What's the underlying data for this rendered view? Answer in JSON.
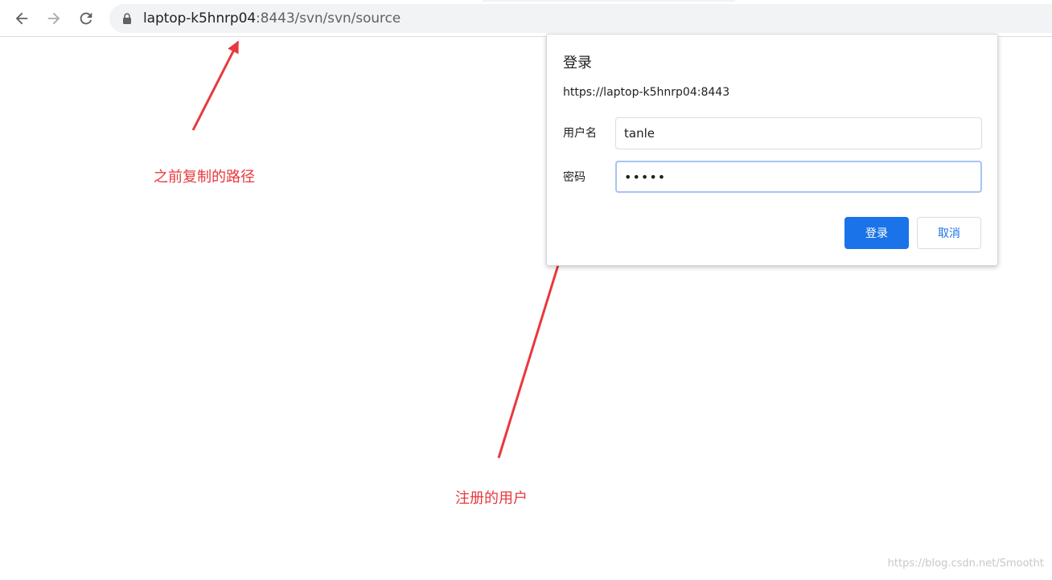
{
  "browser": {
    "url_host": "laptop-k5hnrp04",
    "url_rest": ":8443/svn/svn/source",
    "icons": {
      "back": "arrow-left-icon",
      "forward": "arrow-right-icon",
      "reload": "reload-icon",
      "lock": "lock-icon"
    }
  },
  "dialog": {
    "title": "登录",
    "origin": "https://laptop-k5hnrp04:8443",
    "username_label": "用户名",
    "username_value": "tanle",
    "password_label": "密码",
    "password_value": "•••••",
    "login_button": "登录",
    "cancel_button": "取消"
  },
  "annotations": {
    "url_note": "之前复制的路径",
    "user_note": "注册的用户",
    "color": "#e8383d"
  },
  "watermark": "https://blog.csdn.net/Smootht",
  "colors": {
    "accent": "#1a73e8",
    "focus_ring": "#a6c4f2",
    "omnibox_bg": "#f1f3f4"
  }
}
